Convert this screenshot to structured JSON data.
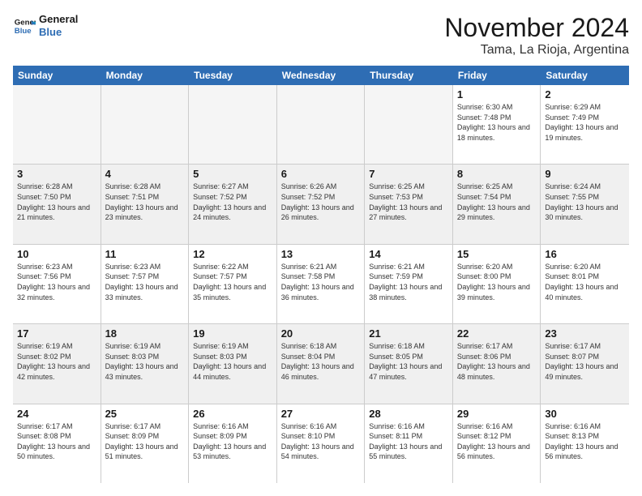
{
  "logo": {
    "line1": "General",
    "line2": "Blue"
  },
  "title": "November 2024",
  "location": "Tama, La Rioja, Argentina",
  "weekdays": [
    "Sunday",
    "Monday",
    "Tuesday",
    "Wednesday",
    "Thursday",
    "Friday",
    "Saturday"
  ],
  "weeks": [
    [
      {
        "day": "",
        "empty": true
      },
      {
        "day": "",
        "empty": true
      },
      {
        "day": "",
        "empty": true
      },
      {
        "day": "",
        "empty": true
      },
      {
        "day": "",
        "empty": true
      },
      {
        "day": "1",
        "sunrise": "6:30 AM",
        "sunset": "7:48 PM",
        "daylight": "13 hours and 18 minutes."
      },
      {
        "day": "2",
        "sunrise": "6:29 AM",
        "sunset": "7:49 PM",
        "daylight": "13 hours and 19 minutes."
      }
    ],
    [
      {
        "day": "3",
        "sunrise": "6:28 AM",
        "sunset": "7:50 PM",
        "daylight": "13 hours and 21 minutes."
      },
      {
        "day": "4",
        "sunrise": "6:28 AM",
        "sunset": "7:51 PM",
        "daylight": "13 hours and 23 minutes."
      },
      {
        "day": "5",
        "sunrise": "6:27 AM",
        "sunset": "7:52 PM",
        "daylight": "13 hours and 24 minutes."
      },
      {
        "day": "6",
        "sunrise": "6:26 AM",
        "sunset": "7:52 PM",
        "daylight": "13 hours and 26 minutes."
      },
      {
        "day": "7",
        "sunrise": "6:25 AM",
        "sunset": "7:53 PM",
        "daylight": "13 hours and 27 minutes."
      },
      {
        "day": "8",
        "sunrise": "6:25 AM",
        "sunset": "7:54 PM",
        "daylight": "13 hours and 29 minutes."
      },
      {
        "day": "9",
        "sunrise": "6:24 AM",
        "sunset": "7:55 PM",
        "daylight": "13 hours and 30 minutes."
      }
    ],
    [
      {
        "day": "10",
        "sunrise": "6:23 AM",
        "sunset": "7:56 PM",
        "daylight": "13 hours and 32 minutes."
      },
      {
        "day": "11",
        "sunrise": "6:23 AM",
        "sunset": "7:57 PM",
        "daylight": "13 hours and 33 minutes."
      },
      {
        "day": "12",
        "sunrise": "6:22 AM",
        "sunset": "7:57 PM",
        "daylight": "13 hours and 35 minutes."
      },
      {
        "day": "13",
        "sunrise": "6:21 AM",
        "sunset": "7:58 PM",
        "daylight": "13 hours and 36 minutes."
      },
      {
        "day": "14",
        "sunrise": "6:21 AM",
        "sunset": "7:59 PM",
        "daylight": "13 hours and 38 minutes."
      },
      {
        "day": "15",
        "sunrise": "6:20 AM",
        "sunset": "8:00 PM",
        "daylight": "13 hours and 39 minutes."
      },
      {
        "day": "16",
        "sunrise": "6:20 AM",
        "sunset": "8:01 PM",
        "daylight": "13 hours and 40 minutes."
      }
    ],
    [
      {
        "day": "17",
        "sunrise": "6:19 AM",
        "sunset": "8:02 PM",
        "daylight": "13 hours and 42 minutes."
      },
      {
        "day": "18",
        "sunrise": "6:19 AM",
        "sunset": "8:03 PM",
        "daylight": "13 hours and 43 minutes."
      },
      {
        "day": "19",
        "sunrise": "6:19 AM",
        "sunset": "8:03 PM",
        "daylight": "13 hours and 44 minutes."
      },
      {
        "day": "20",
        "sunrise": "6:18 AM",
        "sunset": "8:04 PM",
        "daylight": "13 hours and 46 minutes."
      },
      {
        "day": "21",
        "sunrise": "6:18 AM",
        "sunset": "8:05 PM",
        "daylight": "13 hours and 47 minutes."
      },
      {
        "day": "22",
        "sunrise": "6:17 AM",
        "sunset": "8:06 PM",
        "daylight": "13 hours and 48 minutes."
      },
      {
        "day": "23",
        "sunrise": "6:17 AM",
        "sunset": "8:07 PM",
        "daylight": "13 hours and 49 minutes."
      }
    ],
    [
      {
        "day": "24",
        "sunrise": "6:17 AM",
        "sunset": "8:08 PM",
        "daylight": "13 hours and 50 minutes."
      },
      {
        "day": "25",
        "sunrise": "6:17 AM",
        "sunset": "8:09 PM",
        "daylight": "13 hours and 51 minutes."
      },
      {
        "day": "26",
        "sunrise": "6:16 AM",
        "sunset": "8:09 PM",
        "daylight": "13 hours and 53 minutes."
      },
      {
        "day": "27",
        "sunrise": "6:16 AM",
        "sunset": "8:10 PM",
        "daylight": "13 hours and 54 minutes."
      },
      {
        "day": "28",
        "sunrise": "6:16 AM",
        "sunset": "8:11 PM",
        "daylight": "13 hours and 55 minutes."
      },
      {
        "day": "29",
        "sunrise": "6:16 AM",
        "sunset": "8:12 PM",
        "daylight": "13 hours and 56 minutes."
      },
      {
        "day": "30",
        "sunrise": "6:16 AM",
        "sunset": "8:13 PM",
        "daylight": "13 hours and 56 minutes."
      }
    ]
  ]
}
